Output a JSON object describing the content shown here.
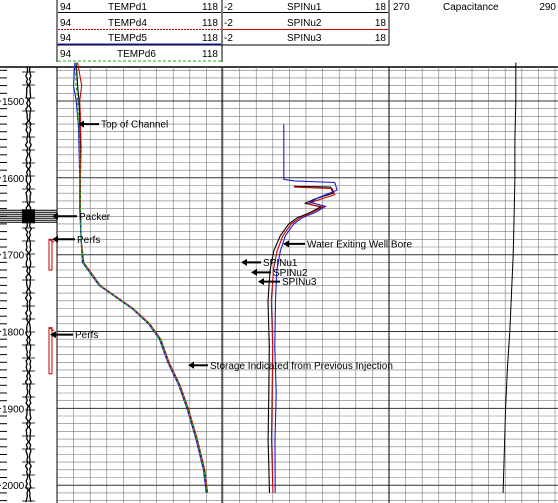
{
  "header": {
    "rows": [
      {
        "min": "94",
        "name": "TEMPd1",
        "max": "118"
      },
      {
        "min": "94",
        "name": "TEMPd4",
        "max": "118"
      },
      {
        "min": "94",
        "name": "TEMPd5",
        "max": "118"
      },
      {
        "min": "94",
        "name": "TEMPd6",
        "max": "118"
      }
    ],
    "spin_rows": [
      {
        "min": "-2",
        "name": "SPINu1",
        "max": "18"
      },
      {
        "min": "-2",
        "name": "SPINu2",
        "max": "18"
      },
      {
        "min": "-2",
        "name": "SPINu3",
        "max": "18"
      }
    ],
    "cap": {
      "min": "270",
      "name": "Capacitance",
      "max": "290"
    }
  },
  "colors": {
    "TEMPd1": "#000000",
    "TEMPd4": "#cc0000",
    "TEMPd5": "#1c1cd0",
    "TEMPd6": "#14b414",
    "grid": "#7a7a7a",
    "annotation": "#000000"
  },
  "chart_data": {
    "type": "line",
    "y_axis": {
      "label": "",
      "range": [
        1440,
        2015
      ],
      "ticks": [
        1500,
        1600,
        1700,
        1800,
        1900,
        2000
      ]
    },
    "depth_labels": [
      "1500",
      "1600",
      "1700",
      "1800",
      "1900",
      "2000"
    ],
    "series": [
      {
        "name": "TEMPd1",
        "x": [
          96.8,
          97.0,
          97.2,
          97.3,
          97.3,
          97.4,
          97.4,
          97.4,
          97.5,
          97.8,
          100.2,
          105.0,
          107.4,
          109.0,
          110.2,
          111.8,
          113.0,
          114.3,
          115.4,
          115.8
        ],
        "y": [
          1450,
          1480,
          1500,
          1520,
          1530,
          1560,
          1600,
          1640,
          1680,
          1710,
          1740,
          1770,
          1790,
          1810,
          1840,
          1870,
          1900,
          1940,
          1980,
          2010
        ]
      },
      {
        "name": "TEMPd4",
        "x": [
          97.0,
          97.6,
          97.3,
          97.4,
          97.4,
          97.5,
          97.4,
          97.4,
          97.5,
          97.9,
          100.3,
          105.1,
          107.5,
          109.1,
          110.3,
          111.9,
          113.1,
          114.4,
          115.5,
          115.9
        ],
        "y": [
          1450,
          1480,
          1500,
          1520,
          1530,
          1560,
          1600,
          1640,
          1680,
          1710,
          1740,
          1770,
          1790,
          1810,
          1840,
          1870,
          1900,
          1940,
          1980,
          2010
        ]
      },
      {
        "name": "TEMPd5",
        "x": [
          96.6,
          96.4,
          96.8,
          97.0,
          97.1,
          97.2,
          97.3,
          97.3,
          97.5,
          97.7,
          100.1,
          104.9,
          107.3,
          108.9,
          110.1,
          111.7,
          112.9,
          114.2,
          115.3,
          115.7
        ],
        "y": [
          1450,
          1480,
          1500,
          1520,
          1530,
          1560,
          1600,
          1640,
          1680,
          1710,
          1740,
          1770,
          1790,
          1810,
          1840,
          1870,
          1900,
          1940,
          1980,
          2010
        ]
      },
      {
        "name": "TEMPd6",
        "x": [
          96.7,
          96.8,
          97.0,
          97.1,
          97.2,
          97.3,
          97.35,
          97.4,
          97.5,
          97.8,
          100.2,
          105.0,
          107.4,
          109.0,
          110.2,
          111.8,
          113.0,
          114.3,
          115.4,
          115.8
        ],
        "y": [
          1450,
          1480,
          1500,
          1520,
          1530,
          1560,
          1600,
          1640,
          1680,
          1710,
          1740,
          1770,
          1790,
          1810,
          1840,
          1870,
          1900,
          1940,
          1980,
          2010
        ]
      },
      {
        "name": "SPINu1",
        "x": [
          6.7,
          6.7,
          11.0,
          11.3,
          9.0,
          8.0,
          9.8,
          8.6,
          7.0,
          6.0,
          5.0,
          4.2,
          3.7,
          3.6,
          3.6,
          3.6,
          3.6,
          3.6
        ],
        "y": [
          1610,
          1611,
          1612,
          1620,
          1628,
          1633,
          1638,
          1645,
          1652,
          1660,
          1675,
          1695,
          1720,
          1760,
          1820,
          1880,
          1940,
          2010
        ]
      },
      {
        "name": "SPINu2",
        "x": [
          6.7,
          6.7,
          11.2,
          11.5,
          9.2,
          8.3,
          10.1,
          8.8,
          7.3,
          6.3,
          5.3,
          4.6,
          4.1,
          4.0,
          4.0,
          4.0,
          4.0,
          4.0
        ],
        "y": [
          1610,
          1612,
          1614,
          1622,
          1630,
          1634,
          1638,
          1645,
          1652,
          1660,
          1675,
          1695,
          1720,
          1760,
          1820,
          1880,
          1940,
          2010
        ]
      },
      {
        "name": "SPINu3",
        "x": [
          5.4,
          5.4,
          5.4,
          6.7,
          11.5,
          11.8,
          9.5,
          8.6,
          10.4,
          9.2,
          7.6,
          6.6,
          5.6,
          5.0,
          4.5,
          4.4,
          4.4,
          4.4,
          4.4,
          4.4
        ],
        "y": [
          1530,
          1560,
          1602,
          1604,
          1606,
          1616,
          1626,
          1632,
          1637,
          1645,
          1652,
          1660,
          1675,
          1695,
          1720,
          1760,
          1820,
          1880,
          1940,
          2010
        ]
      },
      {
        "name": "Capacitance",
        "x": [
          285.0,
          285.0,
          284.9,
          284.9,
          284.8,
          284.7,
          284.5,
          284.3,
          284.0,
          283.8,
          283.5
        ],
        "y": [
          1450,
          1500,
          1550,
          1600,
          1650,
          1700,
          1750,
          1800,
          1850,
          1900,
          2010
        ]
      }
    ],
    "track_markers": [
      {
        "type": "packer",
        "label": "Packer",
        "depth": 1650
      },
      {
        "type": "perfs",
        "label": "Perfs",
        "depth_top": 1680,
        "depth_bottom": 1720
      },
      {
        "type": "perfs",
        "label": "Perfs",
        "depth_top": 1795,
        "depth_bottom": 1855
      }
    ],
    "annotations": [
      {
        "text": "Top of Channel",
        "depth": 1530
      },
      {
        "text": "Packer",
        "depth": 1650
      },
      {
        "text": "Perfs",
        "depth": 1680
      },
      {
        "text": "Water Exiting Well Bore",
        "depth": 1686
      },
      {
        "text": "SPINu1",
        "depth": 1710
      },
      {
        "text": "SPINu2",
        "depth": 1723
      },
      {
        "text": "SPINu3",
        "depth": 1735
      },
      {
        "text": "Perfs",
        "depth": 1804
      },
      {
        "text": "Storage Indicated from Previous Injection",
        "depth": 1844
      }
    ],
    "grid": true
  }
}
